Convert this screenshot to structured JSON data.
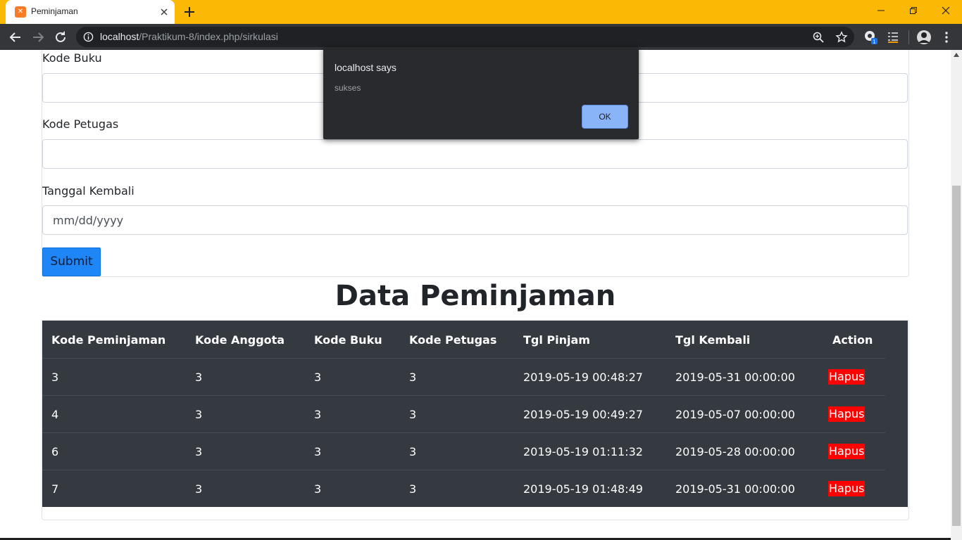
{
  "browser": {
    "tab_title": "Peminjaman",
    "tab_favicon_glyph": "✕",
    "url_host": "localhost",
    "url_path": "/Praktikum-8/index.php/sirkulasi",
    "theme_color": "#fbb905",
    "icons": [
      "info-icon",
      "zoom-icon",
      "star-icon",
      "extension-icon",
      "reading-list-icon",
      "avatar",
      "menu-icon"
    ]
  },
  "form": {
    "labels": {
      "kode_buku": "Kode Buku",
      "kode_petugas": "Kode Petugas",
      "tanggal_kembali": "Tanggal Kembali"
    },
    "tanggal_kembali_placeholder": "mm/dd/yyyy",
    "submit_label": "Submit"
  },
  "table": {
    "heading": "Data Peminjaman",
    "columns": [
      "Kode Peminjaman",
      "Kode Anggota",
      "Kode Buku",
      "Kode Petugas",
      "Tgl Pinjam",
      "Tgl Kembali",
      "Action"
    ],
    "rows": [
      {
        "kode_peminjaman": "3",
        "kode_anggota": "3",
        "kode_buku": "3",
        "kode_petugas": "3",
        "tgl_pinjam": "2019-05-19 00:48:27",
        "tgl_kembali": "2019-05-31 00:00:00",
        "action": "Hapus"
      },
      {
        "kode_peminjaman": "4",
        "kode_anggota": "3",
        "kode_buku": "3",
        "kode_petugas": "3",
        "tgl_pinjam": "2019-05-19 00:49:27",
        "tgl_kembali": "2019-05-07 00:00:00",
        "action": "Hapus"
      },
      {
        "kode_peminjaman": "6",
        "kode_anggota": "3",
        "kode_buku": "3",
        "kode_petugas": "3",
        "tgl_pinjam": "2019-05-19 01:11:32",
        "tgl_kembali": "2019-05-28 00:00:00",
        "action": "Hapus"
      },
      {
        "kode_peminjaman": "7",
        "kode_anggota": "3",
        "kode_buku": "3",
        "kode_petugas": "3",
        "tgl_pinjam": "2019-05-19 01:48:49",
        "tgl_kembali": "2019-05-31 00:00:00",
        "action": "Hapus"
      }
    ]
  },
  "dialog": {
    "title": "localhost says",
    "message": "sukses",
    "ok_label": "OK"
  }
}
